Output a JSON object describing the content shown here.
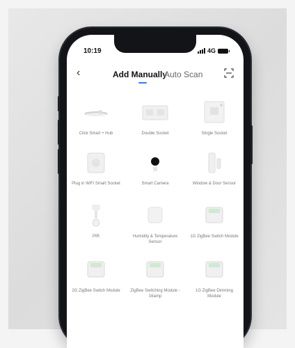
{
  "status_bar": {
    "time": "10:19",
    "network": "4G"
  },
  "header": {
    "back": "back",
    "tab_active": "Add Manually",
    "tab_inactive": "Auto Scan",
    "scan": "scan-code"
  },
  "devices": [
    {
      "name": "Click Smart + Hub"
    },
    {
      "name": "Double Socket"
    },
    {
      "name": "Single Socket"
    },
    {
      "name": "Plug in WiFi Smart Socket"
    },
    {
      "name": "Smart Camera"
    },
    {
      "name": "Window & Door Sensor"
    },
    {
      "name": "PIR"
    },
    {
      "name": "Humidity & Temperature Sensor"
    },
    {
      "name": "1G ZigBee Switch Module"
    },
    {
      "name": "2G ZigBee Switch Module"
    },
    {
      "name": "ZigBee Switching Module - 16amp"
    },
    {
      "name": "1G ZigBee Dimming Module"
    }
  ],
  "colors": {
    "accent": "#2f7cf6",
    "phone": "#121418",
    "background": "#e4e4e4"
  }
}
